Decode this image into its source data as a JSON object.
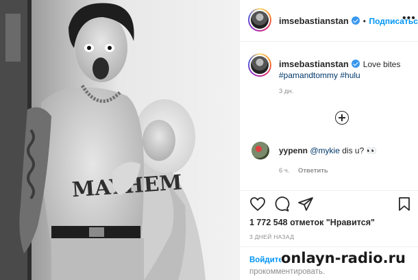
{
  "post": {
    "author": "imsebastianstan",
    "follow_label": "Подписаться",
    "more_label": "•••",
    "photo_alt": "Black and white photo: tattooed shirtless man with open mouth and a blonde woman leaning on his chest"
  },
  "caption": {
    "author": "imsebastianstan",
    "text": "Love bites",
    "hashtags": "#pamandtommy #hulu",
    "time": "3 дн."
  },
  "comment": {
    "author": "yypenn",
    "mention": "@mykie",
    "text": "dis u?",
    "emoji": "👀",
    "time": "6 ч.",
    "reply_label": "Ответить"
  },
  "actions": {
    "like": "heart-icon",
    "comment": "comment-icon",
    "share": "share-icon",
    "save": "bookmark-icon"
  },
  "likes_text": "1 772 548 отметок \"Нравится\"",
  "date_text": "3 ДНЕЙ НАЗАД",
  "login": {
    "link": "Войдите",
    "rest": "прокомментировать."
  },
  "watermark": "onlayn-radio.ru",
  "colors": {
    "accent": "#0095f6",
    "verified": "#3897f0",
    "text": "#262626",
    "muted": "#8e8e8e"
  }
}
